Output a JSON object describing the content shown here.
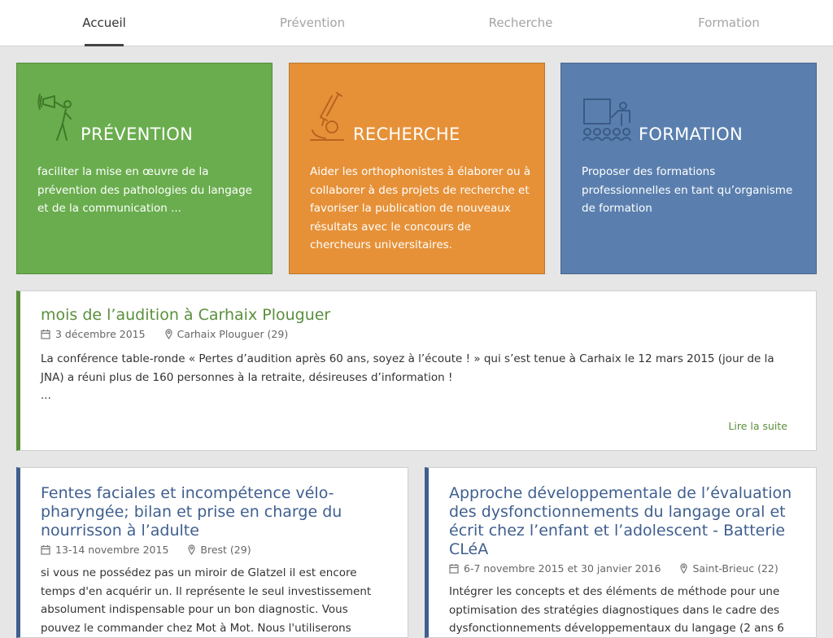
{
  "nav": {
    "items": [
      {
        "label": "Accueil"
      },
      {
        "label": "Prévention"
      },
      {
        "label": "Recherche"
      },
      {
        "label": "Formation"
      }
    ]
  },
  "tiles": [
    {
      "title": "PRÉVENTION",
      "description": "faciliter la mise en œuvre de la prévention des pathologies du langage et de la communication ...",
      "icon": "megaphone-person-icon",
      "color": "#6aad4e"
    },
    {
      "title": "RECHERCHE",
      "description": "Aider les orthophonistes à élaborer ou à collaborer à des projets de recherche et favoriser la publication de nouveaux résultats avec le concours de chercheurs universitaires.",
      "icon": "microscope-icon",
      "color": "#e69138"
    },
    {
      "title": "FORMATION",
      "description": "Proposer des formations professionnelles en tant qu’organisme de formation",
      "icon": "classroom-icon",
      "color": "#5a7fae"
    }
  ],
  "featured": {
    "title": "mois de l’audition à Carhaix Plouguer",
    "date": "3 décembre 2015",
    "location": "Carhaix Plouguer (29)",
    "body": "La conférence table-ronde « Pertes d’audition après 60 ans, soyez à l’écoute ! » qui s’est tenue à Carhaix le 12 mars 2015 (jour de la JNA) a réuni plus de 160 personnes à la retraite, désireuses d’information !",
    "ellipsis": "...",
    "readmore": "Lire la suite",
    "accent": "#5a8f3c"
  },
  "articles": [
    {
      "title": "Fentes faciales et incompétence vélo-pharyngée; bilan et prise en charge du nourrisson à l’adulte",
      "date": "13-14 novembre 2015",
      "location": "Brest (29)",
      "body": "si vous ne possédez pas un miroir de Glatzel il est encore temps d'en acquérir un. Il représente le seul investissement absolument indispensable pour un bon diagnostic. Vous pouvez le commander chez Mot à Mot. Nous l'utiliserons",
      "accent": "#3f5f8f"
    },
    {
      "title": "Approche développementale de l’évaluation des dysfonctionnements du langage oral et écrit chez l’enfant et l’adolescent - Batterie CLéA",
      "date": "6-7 novembre 2015 et 30 janvier 2016",
      "location": "Saint-Brieuc (22)",
      "body": "Intégrer les concepts et des éléments de méthode pour une optimisation des stratégies diagnostiques dans le cadre des dysfonctionnements développementaux du langage (2 ans 6",
      "accent": "#3f5f8f"
    }
  ]
}
